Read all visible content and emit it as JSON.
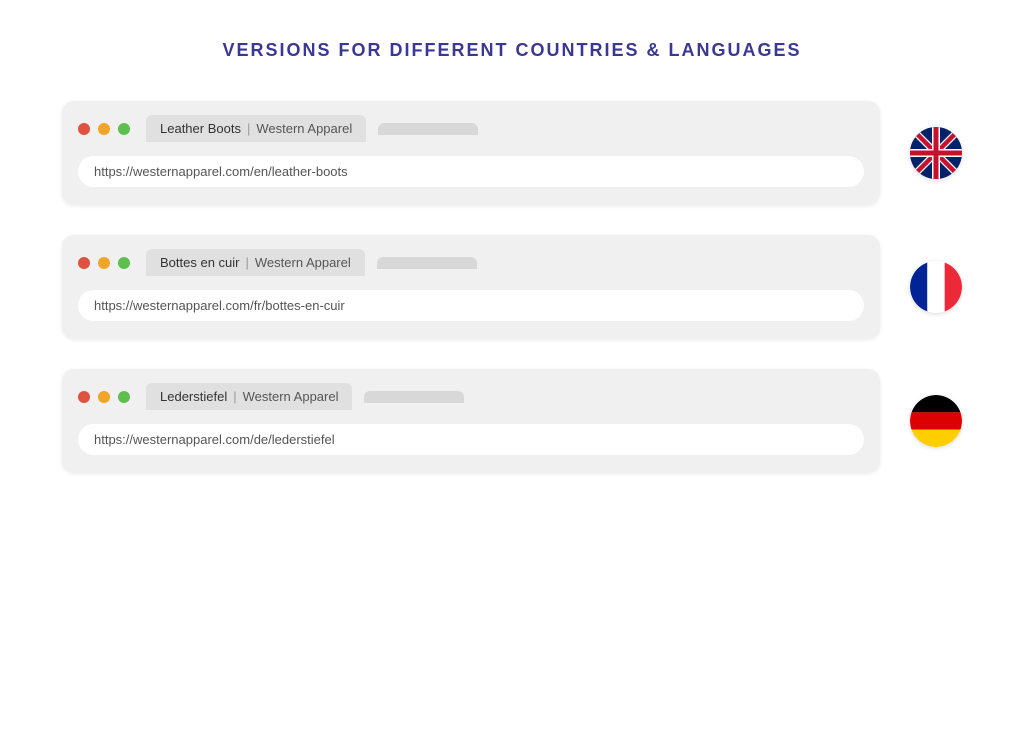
{
  "page": {
    "title": "VERSIONS FOR DIFFERENT COUNTRIES & LANGUAGES"
  },
  "browsers": [
    {
      "id": "en",
      "tab_main": "Leather Boots",
      "tab_separator": "|",
      "tab_site": "Western Apparel",
      "url": "https://westernapparel.com/en/leather-boots",
      "flag_label": "UK flag"
    },
    {
      "id": "fr",
      "tab_main": "Bottes en cuir",
      "tab_separator": "|",
      "tab_site": "Western Apparel",
      "url": "https://westernapparel.com/fr/bottes-en-cuir",
      "flag_label": "French flag"
    },
    {
      "id": "de",
      "tab_main": "Lederstiefel",
      "tab_separator": "|",
      "tab_site": "Western Apparel",
      "url": "https://westernapparel.com/de/lederstiefel",
      "flag_label": "German flag"
    }
  ],
  "dots": {
    "red_label": "red dot",
    "orange_label": "orange dot",
    "green_label": "green dot"
  }
}
